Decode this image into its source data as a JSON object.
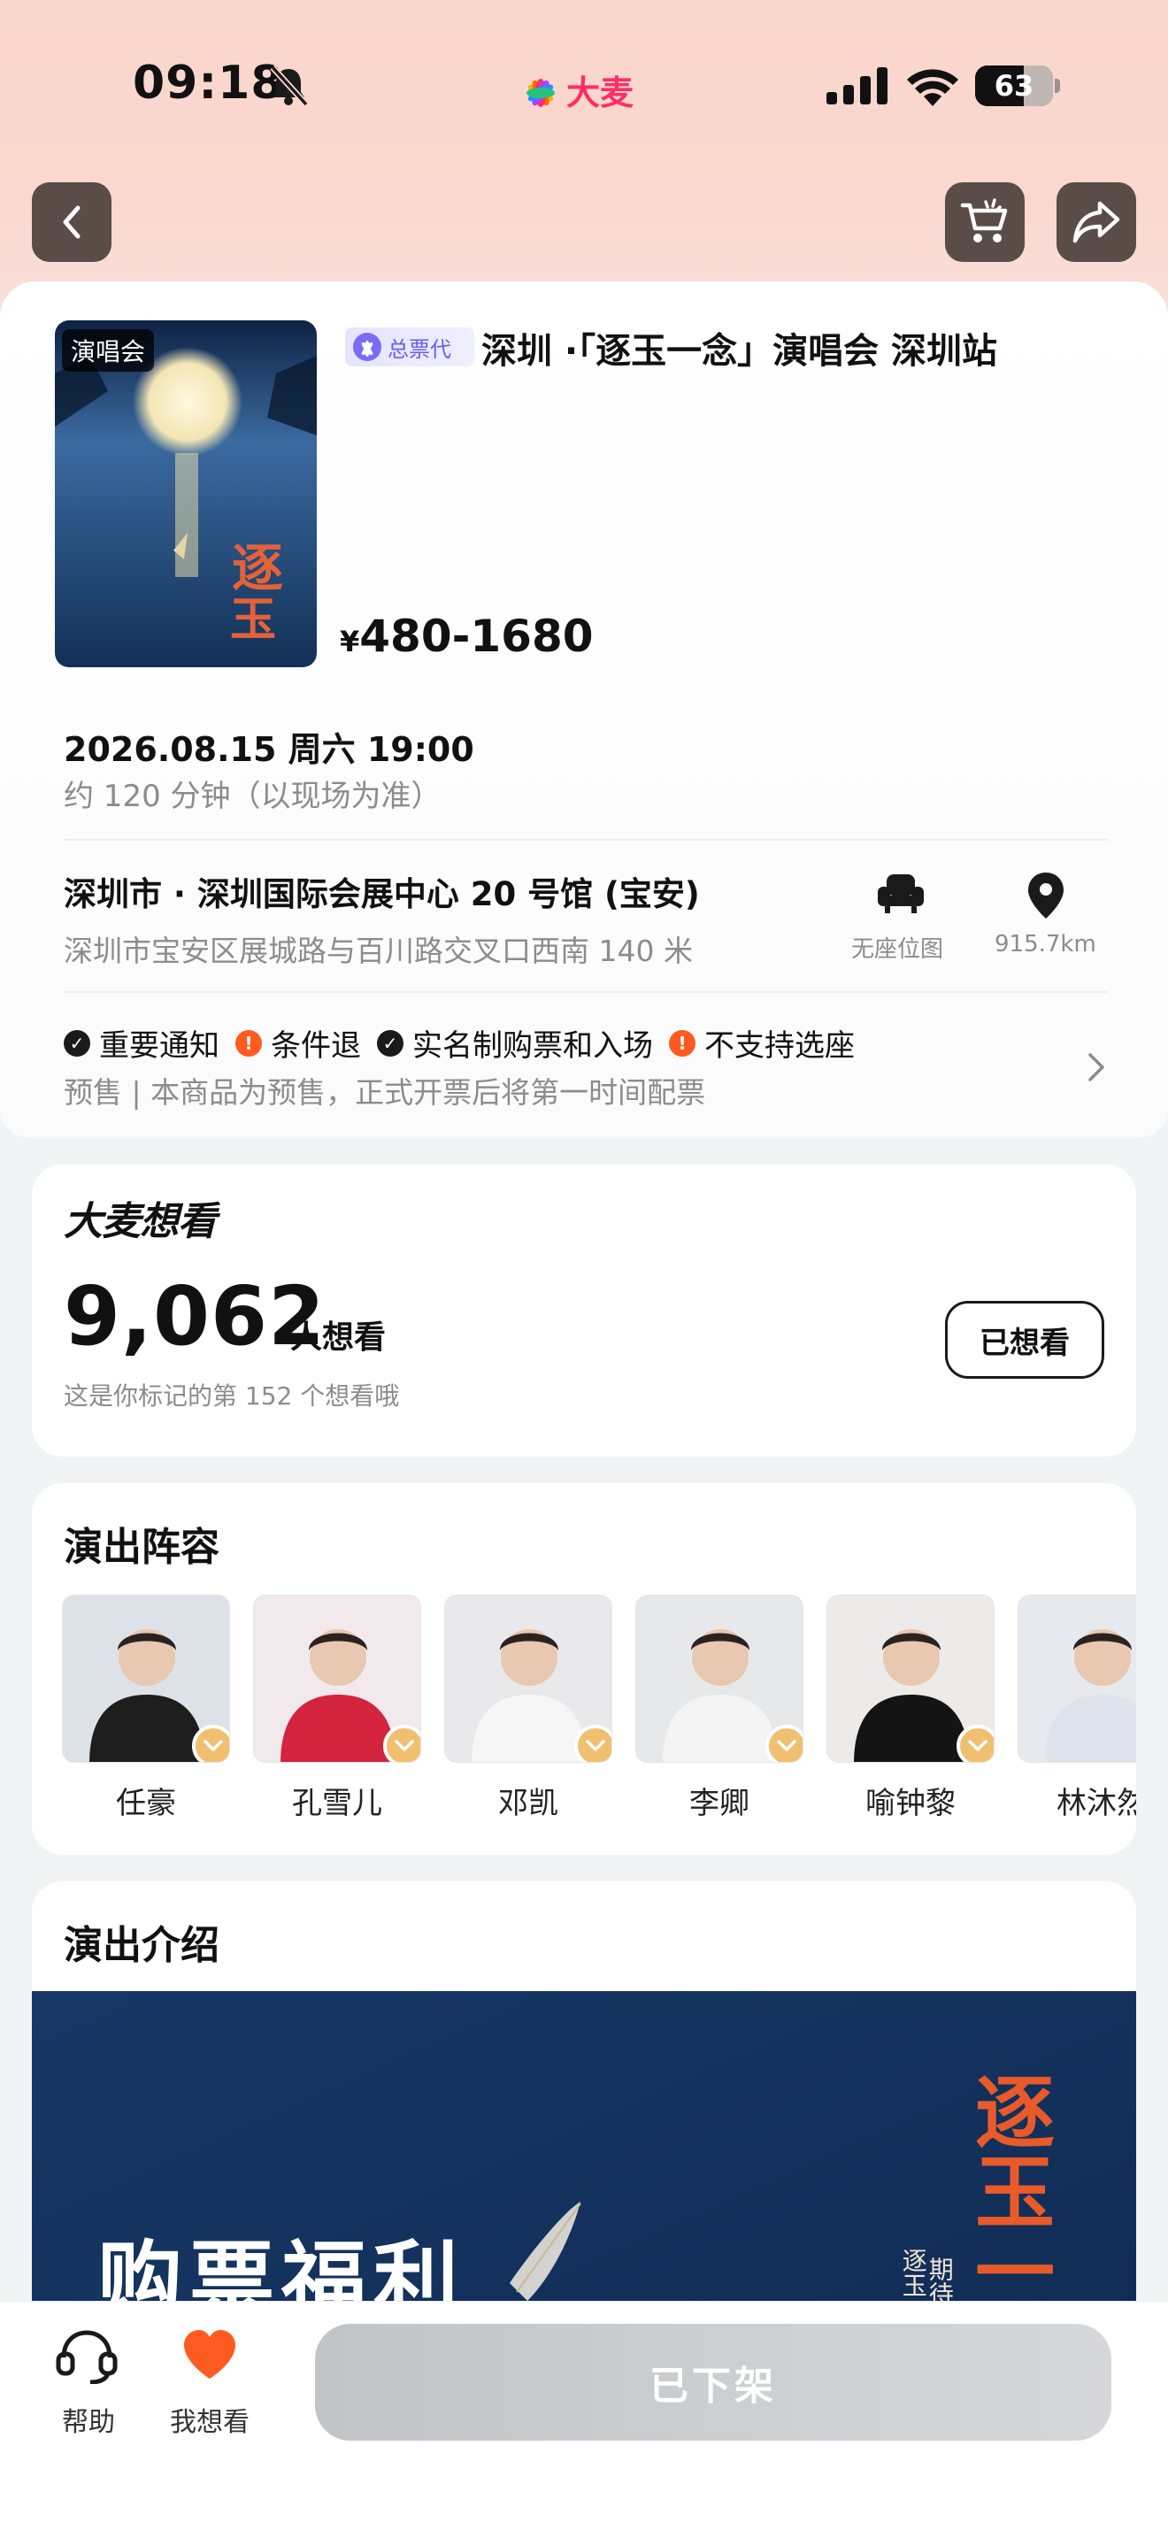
{
  "status_bar": {
    "time": "09:18",
    "brand": "大麦",
    "battery": "63",
    "battery_level": 0.63
  },
  "event": {
    "poster_tag": "演唱会",
    "agent_badge": "总票代",
    "title": "深圳 ·「逐玉一念」演唱会 深圳站",
    "price_symbol": "¥",
    "price": "480-1680",
    "date": "2026.08.15 周六 19:00",
    "duration": "约 120 分钟（以现场为准）",
    "venue": "深圳市 · 深圳国际会展中心 20 号馆 (宝安)",
    "address": "深圳市宝安区展城路与百川路交叉口西南 140 米",
    "seat_map_label": "无座位图",
    "distance": "915.7km",
    "notices": [
      {
        "type": "check",
        "label": "重要通知"
      },
      {
        "type": "warn",
        "label": "条件退"
      },
      {
        "type": "check",
        "label": "实名制购票和入场"
      },
      {
        "type": "warn",
        "label": "不支持选座"
      }
    ],
    "presale": "预售 | 本商品为预售，正式开票后将第一时间配票"
  },
  "want_section": {
    "logo": "大麦想看",
    "count": "9,062",
    "unit": "人想看",
    "note": "这是你标记的第 152 个想看哦",
    "button": "已想看"
  },
  "cast_section": {
    "title": "演出阵容",
    "members": [
      {
        "name": "任豪",
        "bg": "#dde2e8",
        "outfit": "#1e1e1e"
      },
      {
        "name": "孔雪儿",
        "bg": "#f1e9ec",
        "outfit": "#d4233c"
      },
      {
        "name": "邓凯",
        "bg": "#e9e9eb",
        "outfit": "#f6f6f6"
      },
      {
        "name": "李卿",
        "bg": "#e7e8ea",
        "outfit": "#f4f4f4"
      },
      {
        "name": "喻钟黎",
        "bg": "#ecebea",
        "outfit": "#141414"
      },
      {
        "name": "林沐然",
        "bg": "#e6e9ee",
        "outfit": "#dfe4ec"
      }
    ]
  },
  "intro_section": {
    "title": "演出介绍",
    "banner_text": "购票福利",
    "banner_brand": "逐玉一念",
    "banner_line1": "逐玉一念",
    "banner_line2": "期待相见"
  },
  "bottom_bar": {
    "help": "帮助",
    "want": "我想看",
    "action": "已下架"
  },
  "colors": {
    "brand_pink": "#ff2d64",
    "accent_orange": "#ff5a1f",
    "badge_purple": "#6a5cf0",
    "disabled_gray": "#c8c9cd"
  }
}
